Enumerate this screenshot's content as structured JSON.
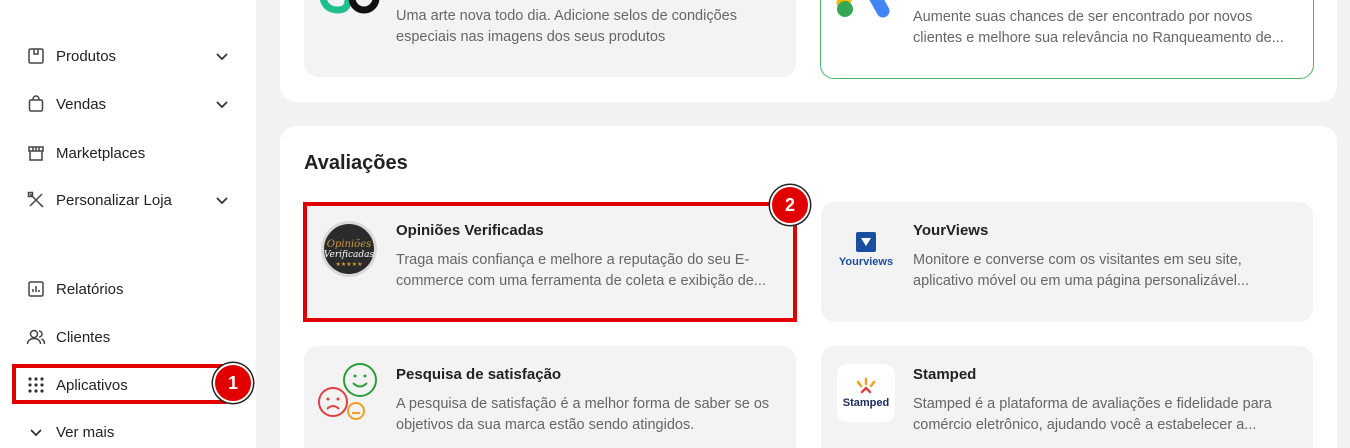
{
  "sidebar": {
    "items": [
      {
        "label": "Produtos",
        "icon": "box-icon",
        "has_chevron": true
      },
      {
        "label": "Vendas",
        "icon": "shopping-bag-icon",
        "has_chevron": true
      },
      {
        "label": "Marketplaces",
        "icon": "store-icon",
        "has_chevron": false
      },
      {
        "label": "Personalizar Loja",
        "icon": "tools-icon",
        "has_chevron": true
      },
      {
        "label": "Relatórios",
        "icon": "report-chart-icon",
        "has_chevron": false
      },
      {
        "label": "Clientes",
        "icon": "users-icon",
        "has_chevron": false
      },
      {
        "label": "Aplicativos",
        "icon": "grid-dots-icon",
        "has_chevron": false
      },
      {
        "label": "Ver mais",
        "icon": "chevron-down-icon",
        "has_chevron": false
      }
    ]
  },
  "top_cards": [
    {
      "desc_line1": "Uma arte nova todo dia. Adicione selos de condições",
      "desc_line2": "especiais nas imagens dos seus produtos",
      "logo": "arts-logo-icon"
    },
    {
      "desc_line1": "Aumente suas chances de ser encontrado por novos",
      "desc_line2": "clientes e melhore sua relevância no Ranqueamento de...",
      "logo": "google-ads-icon"
    }
  ],
  "reviews": {
    "title": "Avaliações",
    "cards": [
      {
        "title": "Opiniões Verificadas",
        "desc_line1": "Traga mais confiança e melhore a reputação do seu E-",
        "desc_line2": "commerce com uma ferramenta de coleta e exibição de...",
        "logo_text": "Opiniões",
        "logo_text2": "Verificadas"
      },
      {
        "title": "YourViews",
        "desc_line1": "Monitore e converse com os visitantes em seu site,",
        "desc_line2": "aplicativo móvel ou em uma página personalizável...",
        "logo_text": "Yourviews"
      },
      {
        "title": "Pesquisa de satisfação",
        "desc_line1": "A pesquisa de satisfação é a melhor forma de saber se os",
        "desc_line2": "objetivos da sua marca estão sendo atingidos.",
        "logo": "satisfaction-faces-icon"
      },
      {
        "title": "Stamped",
        "desc_line1": "Stamped é a plataforma de avaliações e fidelidade para",
        "desc_line2": "comércio eletrônico, ajudando você a estabelecer a...",
        "logo_text": "Stamped"
      }
    ]
  },
  "annotations": {
    "badge1": "1",
    "badge2": "2",
    "color": "#e00000"
  },
  "colors": {
    "accent_green": "#52b36a",
    "annotation_red": "#e00000"
  }
}
